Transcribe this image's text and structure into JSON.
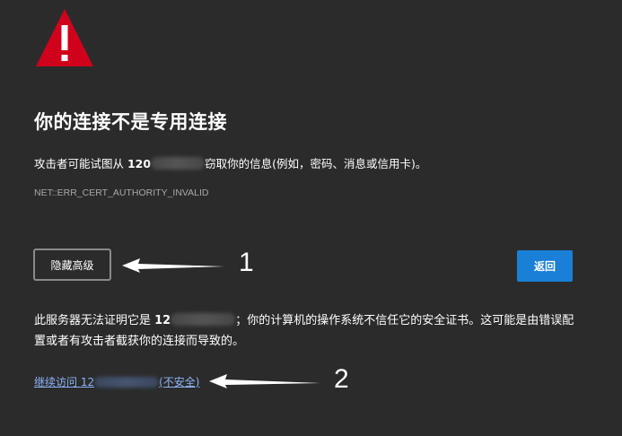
{
  "interstitial": {
    "title": "你的连接不是专用连接",
    "description_prefix": "攻击者可能试图从 ",
    "host_visible": "120",
    "description_suffix": "窃取你的信息(例如，密码、消息或信用卡)。",
    "error_code": "NET::ERR_CERT_AUTHORITY_INVALID",
    "hide_advanced_label": "隐藏高级",
    "back_label": "返回",
    "explanation_prefix": "此服务器无法证明它是 ",
    "explanation_host_visible": "12",
    "explanation_suffix": "；你的计算机的操作系统不信任它的安全证书。这可能是由错误配置或者有攻击者截获你的连接而导致的。",
    "proceed_prefix": "继续访问 ",
    "proceed_host_visible": "12",
    "proceed_suffix": "(不安全)"
  },
  "annotations": {
    "label_1": "1",
    "label_2": "2"
  },
  "colors": {
    "background": "#2b2b2b",
    "warning_red": "#d0021b",
    "primary_button": "#1a7fd6",
    "link": "#8ab4f8"
  },
  "icons": {
    "warning": "warning-triangle-icon"
  }
}
